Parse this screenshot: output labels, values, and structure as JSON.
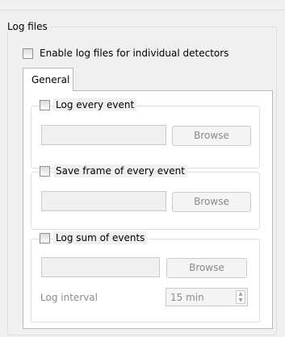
{
  "log_files": {
    "title": "Log files",
    "enable_label": "Enable log files for individual detectors",
    "tab_general": "General",
    "log_every_event": {
      "label": "Log every event",
      "path_value": "",
      "browse_label": "Browse"
    },
    "save_frame": {
      "label": "Save frame of every event",
      "path_value": "",
      "browse_label": "Browse"
    },
    "log_sum": {
      "label": "Log sum of events",
      "path_value": "",
      "browse_label": "Browse",
      "interval_label": "Log interval",
      "interval_value": "15 min"
    }
  }
}
